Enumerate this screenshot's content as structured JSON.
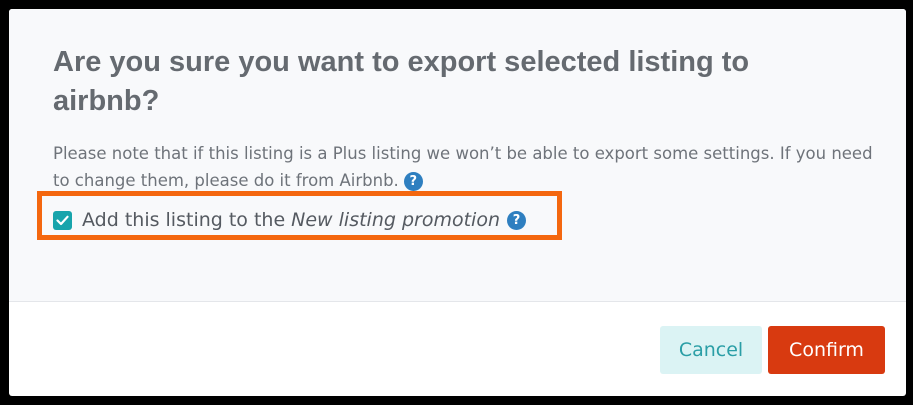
{
  "dialog": {
    "title": "Are you sure you want to export selected listing to airbnb?",
    "note": "Please note that if this listing is a Plus listing we won’t be able to export some settings. If you need to change them, please do it from Airbnb.",
    "note_help_icon": "question-circle-icon",
    "promotion": {
      "checked": true,
      "label": "Add this listing to the",
      "promotion_name": "New listing promotion",
      "help_icon": "question-circle-icon"
    },
    "actions": {
      "cancel_label": "Cancel",
      "confirm_label": "Confirm"
    }
  },
  "colors": {
    "title": "#656a70",
    "checkbox": "#17a4ac",
    "help_icon": "#2e7fc0",
    "highlight": "#f4670f",
    "cancel_bg": "#dbf3f4",
    "cancel_text": "#2a9ea6",
    "confirm_bg": "#d83a10"
  }
}
